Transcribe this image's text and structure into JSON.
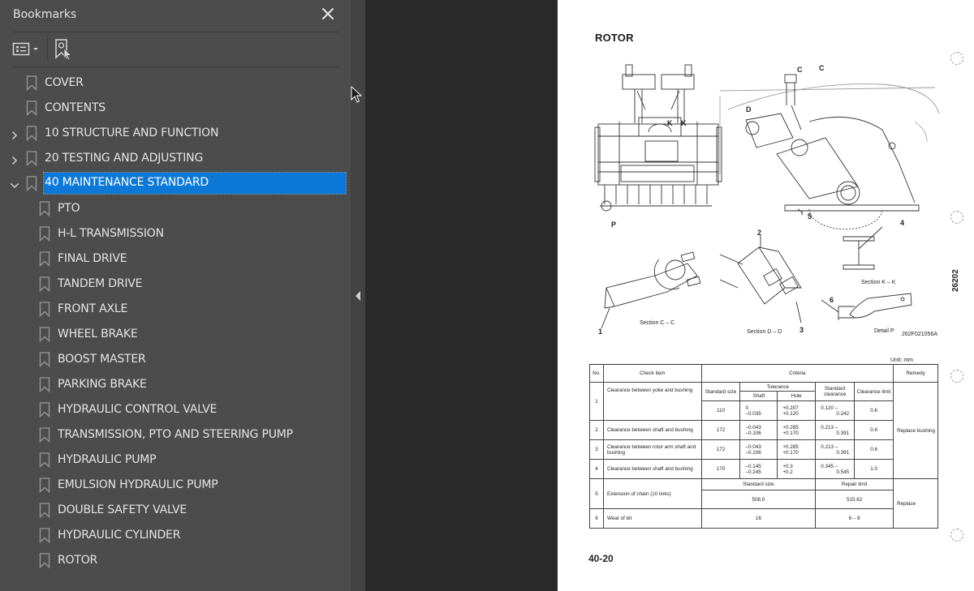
{
  "sidebar": {
    "title": "Bookmarks",
    "close_icon": "close-icon",
    "toolbar": {
      "options_icon": "bookmark-options-icon",
      "new_bookmark_icon": "new-bookmark-from-selection-icon"
    },
    "items": [
      {
        "label": "COVER",
        "level": 0,
        "expander": "none"
      },
      {
        "label": "CONTENTS",
        "level": 0,
        "expander": "none"
      },
      {
        "label": "10 STRUCTURE AND FUNCTION",
        "level": 0,
        "expander": "collapsed"
      },
      {
        "label": "20 TESTING AND ADJUSTING",
        "level": 0,
        "expander": "collapsed"
      },
      {
        "label": "40 MAINTENANCE STANDARD",
        "level": 0,
        "expander": "expanded",
        "selected": true
      },
      {
        "label": "PTO",
        "level": 1
      },
      {
        "label": "H-L TRANSMISSION",
        "level": 1
      },
      {
        "label": "FINAL DRIVE",
        "level": 1
      },
      {
        "label": "TANDEM DRIVE",
        "level": 1
      },
      {
        "label": "FRONT AXLE",
        "level": 1
      },
      {
        "label": "WHEEL BRAKE",
        "level": 1
      },
      {
        "label": "BOOST MASTER",
        "level": 1
      },
      {
        "label": "PARKING BRAKE",
        "level": 1
      },
      {
        "label": "HYDRAULIC CONTROL VALVE",
        "level": 1
      },
      {
        "label": "TRANSMISSION, PTO AND STEERING PUMP",
        "level": 1
      },
      {
        "label": "HYDRAULIC PUMP",
        "level": 1
      },
      {
        "label": "EMULSION HYDRAULIC PUMP",
        "level": 1
      },
      {
        "label": "DOUBLE SAFETY VALVE",
        "level": 1
      },
      {
        "label": "HYDRAULIC CYLINDER",
        "level": 1
      },
      {
        "label": "ROTOR",
        "level": 1
      }
    ]
  },
  "splitter": {
    "collapse_icon": "collapse-left-arrow-icon"
  },
  "colors": {
    "sidebar_bg": "#4c4c4c",
    "selection": "#0c78d8",
    "doc_bg": "#2a2a2a",
    "page_bg": "#ffffff"
  },
  "page": {
    "title": "ROTOR",
    "page_number": "40-20",
    "side_id": "26202",
    "drawing": {
      "labels": {
        "c": "C",
        "d": "D",
        "k": "K",
        "p": "P",
        "n1": "1",
        "n2": "2",
        "n3": "3",
        "n4": "4",
        "n5": "5",
        "n6": "6"
      },
      "captions": {
        "section_cc": "Section C – C",
        "section_dd": "Section D – D",
        "section_kk": "Section K – K",
        "detail_p": "Detail P",
        "drawing_no": "262F021056A"
      }
    },
    "table": {
      "unit": "Unit: mm",
      "headers": {
        "no": "No.",
        "check_item": "Check item",
        "criteria": "Criteria",
        "remedy": "Remedy",
        "standard_size": "Standard size",
        "tolerance": "Tolerance",
        "shaft": "Shaft",
        "hole": "Hole",
        "standard_clearance": "Standard clearance",
        "clearance_limit": "Clearance limit",
        "standard_size_2": "Standard size",
        "repair_limit": "Repair limit"
      },
      "rows": [
        {
          "no": "1",
          "item": "Clearance between yoke and bushing",
          "size": "110",
          "shaft": [
            "0",
            "–0.035"
          ],
          "hole": [
            "+0.207",
            "+0.120"
          ],
          "clearance": [
            "0.120 –",
            "0.242"
          ],
          "limit": "0.6"
        },
        {
          "no": "2",
          "item": "Clearance between shaft and bushing",
          "size": "172",
          "shaft": [
            "–0.043",
            "–0.106"
          ],
          "hole": [
            "+0.285",
            "+0.170"
          ],
          "clearance": [
            "0.213 –",
            "0.391"
          ],
          "limit": "0.6"
        },
        {
          "no": "3",
          "item": "Clearance between rotor  arm shaft and bushing",
          "size": "172",
          "shaft": [
            "–0.043",
            "–0.106"
          ],
          "hole": [
            "+0.285",
            "+0.170"
          ],
          "clearance": [
            "0.213 –",
            "0.391"
          ],
          "limit": "0.6"
        },
        {
          "no": "4",
          "item": "Clearance between shaft and bushing",
          "size": "170",
          "shaft": [
            "–0.145",
            "–0.245"
          ],
          "hole": [
            "+0.3",
            "+0.2"
          ],
          "clearance": [
            "0.345 –",
            "0.545"
          ],
          "limit": "1.0"
        }
      ],
      "remedy_1_4": "Replace bushing",
      "rows_b": [
        {
          "no": "5",
          "item": "Extension of chain (10 links)",
          "standard": "508.0",
          "repair": "515.62"
        },
        {
          "no": "6",
          "item": "Wear of bit",
          "standard": "16",
          "repair": "6 – 8"
        }
      ],
      "remedy_5_6": "Replace"
    }
  }
}
